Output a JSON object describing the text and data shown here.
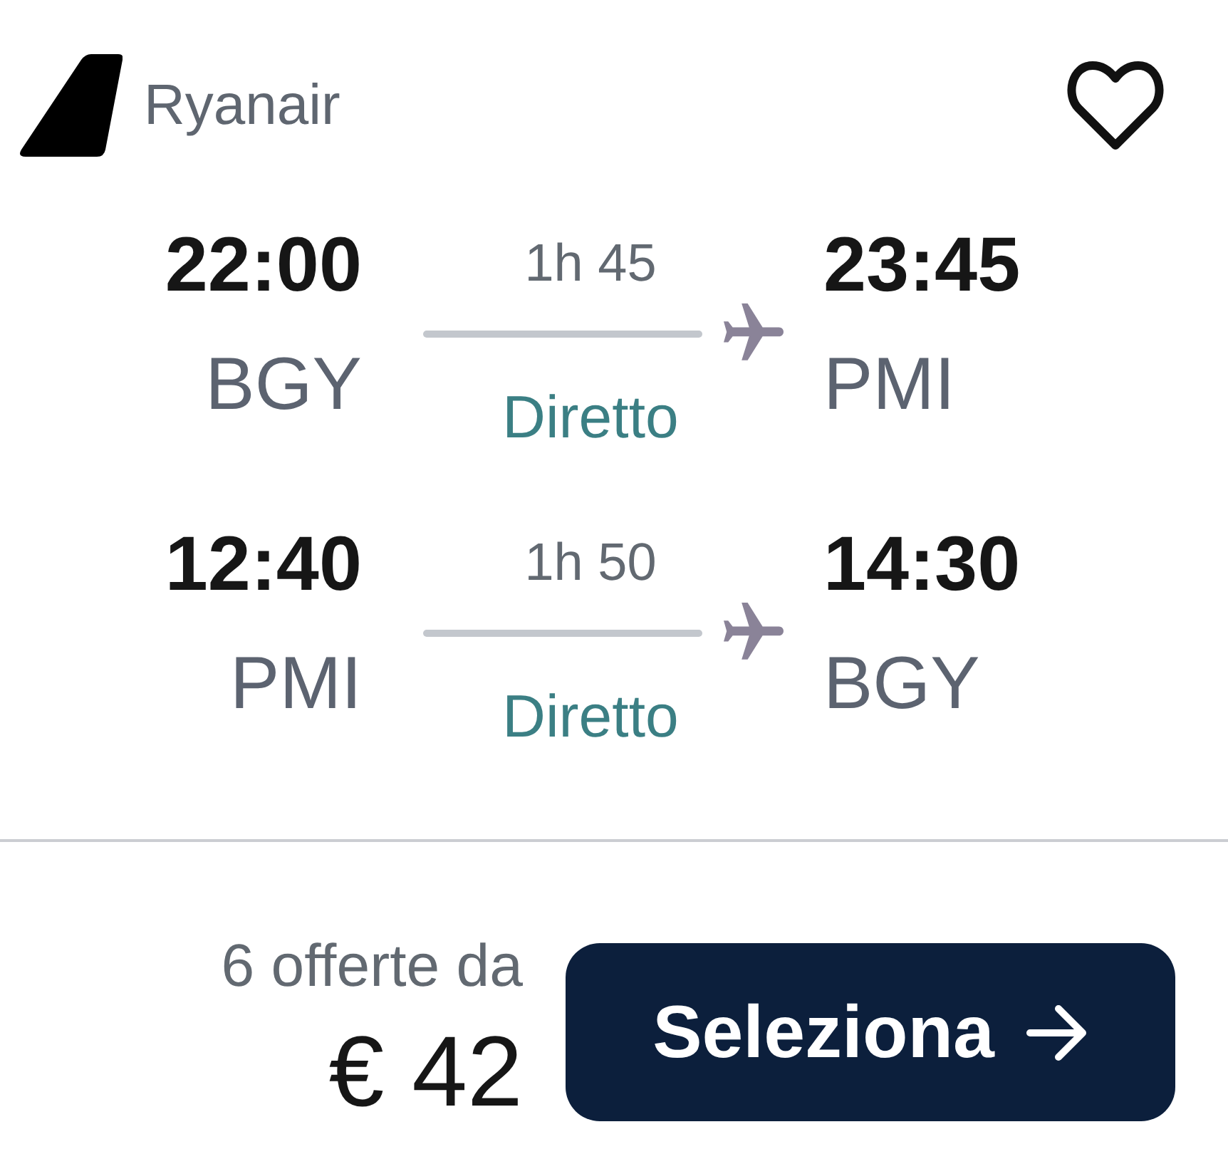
{
  "carrier": {
    "name": "Ryanair"
  },
  "favorite": {
    "saved": false
  },
  "legs": [
    {
      "departure": {
        "time": "22:00",
        "airport": "BGY"
      },
      "duration": "1h 45",
      "stops": "Diretto",
      "arrival": {
        "time": "23:45",
        "airport": "PMI"
      }
    },
    {
      "departure": {
        "time": "12:40",
        "airport": "PMI"
      },
      "duration": "1h 50",
      "stops": "Diretto",
      "arrival": {
        "time": "14:30",
        "airport": "BGY"
      }
    }
  ],
  "price": {
    "offers": "6 offerte da",
    "amount": "€ 42"
  },
  "select_button": {
    "label": "Seleziona"
  }
}
